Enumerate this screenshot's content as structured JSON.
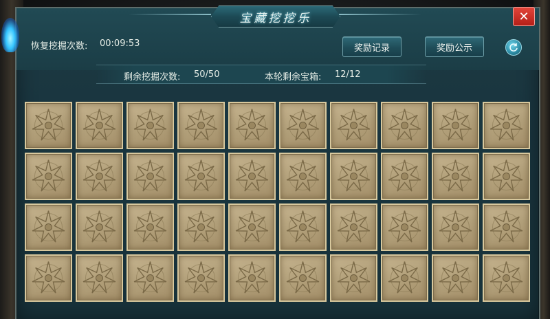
{
  "title": "宝藏挖挖乐",
  "close_symbol": "✕",
  "recovery": {
    "label": "恢复挖掘次数:",
    "timer": "00:09:53"
  },
  "buttons": {
    "records": "奖励记录",
    "announcement": "奖励公示"
  },
  "help_icon": "refresh-icon",
  "stats": {
    "remaining_digs_label": "剩余挖掘次数:",
    "remaining_digs_value": "50/50",
    "remaining_chests_label": "本轮剩余宝箱:",
    "remaining_chests_value": "12/12"
  },
  "grid": {
    "rows": 4,
    "cols": 10,
    "tile_icon": "compass-star-icon"
  },
  "colors": {
    "panel": "#1a3640",
    "tile": "#b2a07a",
    "close": "#c8281f",
    "flame": "#33c3ff"
  }
}
